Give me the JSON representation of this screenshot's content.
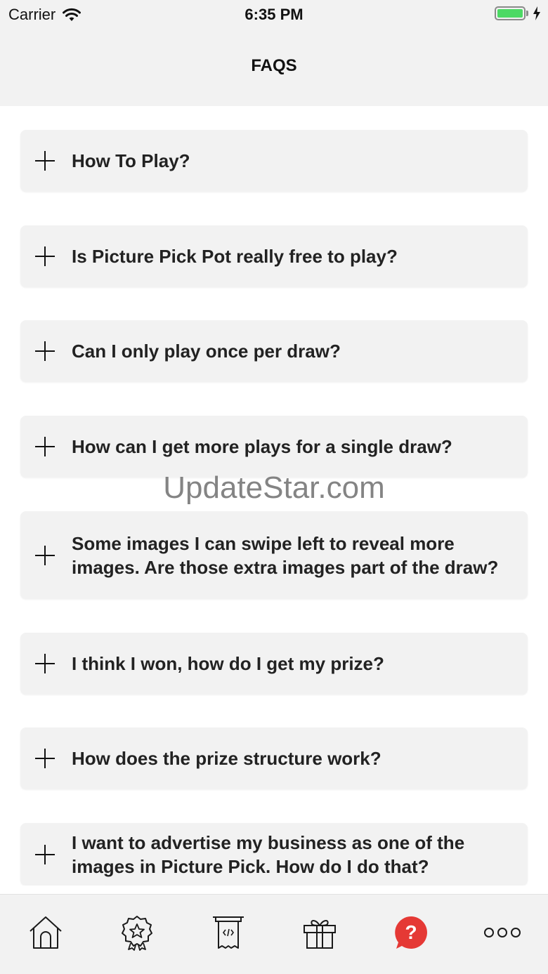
{
  "status_bar": {
    "carrier": "Carrier",
    "time": "6:35 PM",
    "battery_color": "#4cd964"
  },
  "nav": {
    "title": "FAQS"
  },
  "faq": {
    "items": [
      {
        "question": "How To Play?"
      },
      {
        "question": "Is Picture Pick Pot really free to play?"
      },
      {
        "question": "Can I only play once per draw?"
      },
      {
        "question": "How can I get more plays for a single draw?"
      },
      {
        "question": "Some images I can swipe left to reveal more images. Are those extra images part of the draw?"
      },
      {
        "question": "I think I won, how do I get my prize?"
      },
      {
        "question": "How does the prize structure work?"
      },
      {
        "question": "I want to advertise my business as one of the images in Picture Pick. How do I do that?"
      }
    ]
  },
  "watermark": "UpdateStar.com",
  "tab_bar": {
    "active_color": "#e53935",
    "tabs": [
      {
        "icon": "home-icon"
      },
      {
        "icon": "badge-star-icon"
      },
      {
        "icon": "ticket-icon"
      },
      {
        "icon": "gift-icon"
      },
      {
        "icon": "help-icon",
        "label": "?",
        "active": true
      },
      {
        "icon": "more-icon"
      }
    ]
  }
}
